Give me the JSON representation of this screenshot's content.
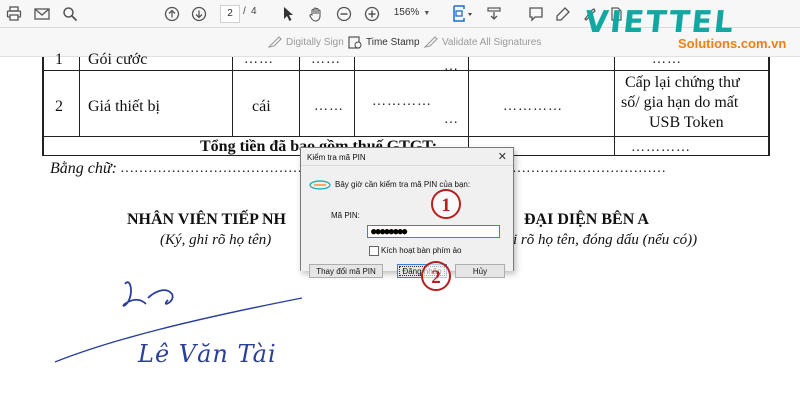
{
  "toolbar": {
    "current_page": "2",
    "page_separator": "/",
    "total_pages": "4",
    "zoom": "156%",
    "icons": [
      "print-icon",
      "mail-icon",
      "search-icon",
      "page-up-icon",
      "page-down-icon",
      "pointer-icon",
      "hand-icon",
      "zoom-out-icon",
      "zoom-in-icon",
      "fit-page-icon",
      "scroll-icon",
      "comment-icon",
      "highlight-icon",
      "draw-icon",
      "sign-icon"
    ]
  },
  "signbar": {
    "digitally_sign": "Digitally Sign",
    "time_stamp": "Time Stamp",
    "validate_all": "Validate All Signatures"
  },
  "logo": {
    "main": "VIETTEL",
    "sub": "Solutions.com.vn",
    "main_color": "#10a8a0",
    "sub_color": "#f08010"
  },
  "document": {
    "row1": {
      "no": "1",
      "name": "Gói cước",
      "c1": "……",
      "c2": "……",
      "c3": "…",
      "c4": "……"
    },
    "row2": {
      "no": "2",
      "name": "Giá thiết bị",
      "unit": "cái",
      "c1": "……",
      "c2": "…………",
      "c2b": "…",
      "c3": "…………",
      "note_line1": "Cấp lại chứng thư",
      "note_line2": "số/ gia hạn do mất",
      "note_line3": "USB Token"
    },
    "total_label": "Tổng tiền đã bao gồm thuế GTGT:",
    "total_dots": "…………",
    "in_words_label": "Bằng chữ:",
    "in_words_dots": "………………………………………………………………………………………………………",
    "left_sign_title": "NHÂN VIÊN TIẾP NH",
    "left_sign_note": "(Ký, ghi rõ họ tên)",
    "right_sign_title": "ĐẠI DIỆN BÊN A",
    "right_sign_note": "i rõ họ tên, đóng dấu (nếu có))",
    "signature_name": "Lê Văn Tài"
  },
  "dialog": {
    "title": "Kiểm tra mã PIN",
    "close": "✕",
    "message": "Bây giờ cần kiểm tra mã PIN của bạn:",
    "pin_label": "Mã PIN:",
    "pin_value": "●●●●●●●●",
    "show_keyboard_label": "Kích hoạt bàn phím ảo",
    "show_keyboard_checked": false,
    "btn_change_pin": "Thay đổi mã PIN",
    "btn_login": "Đăng nhập",
    "btn_cancel": "Hủy"
  },
  "callouts": {
    "first": "1",
    "second": "2",
    "color": "#b52020"
  }
}
